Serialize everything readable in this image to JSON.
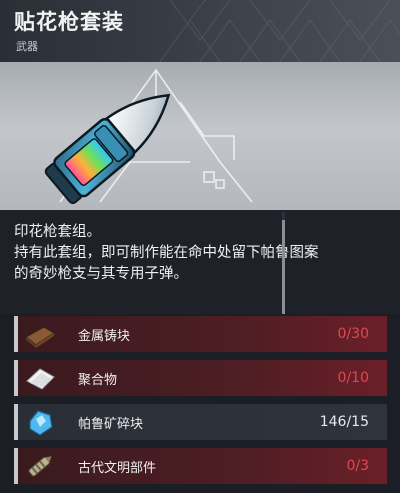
{
  "item": {
    "title": "贴花枪套装",
    "category": "武器"
  },
  "description": {
    "line1": "印花枪套组。",
    "line2": "持有此套组，即可制作能在命中处留下帕鲁图案",
    "line3": "的奇妙枪支与其专用子弹。"
  },
  "materials": [
    {
      "name": "金属铸块",
      "count": "0/30",
      "icon": "metal-ingot-icon",
      "status": "insufficient"
    },
    {
      "name": "聚合物",
      "count": "0/10",
      "icon": "polymer-icon",
      "status": "insufficient"
    },
    {
      "name": "帕鲁矿碎块",
      "count": "146/15",
      "icon": "pal-fragment-icon",
      "status": "sufficient"
    },
    {
      "name": "古代文明部件",
      "count": "0/3",
      "icon": "ancient-part-icon",
      "status": "insufficient"
    }
  ],
  "colors": {
    "insufficient": "#e0484f",
    "sufficient": "#e8eaec",
    "accent_red": "#6b1f28"
  }
}
